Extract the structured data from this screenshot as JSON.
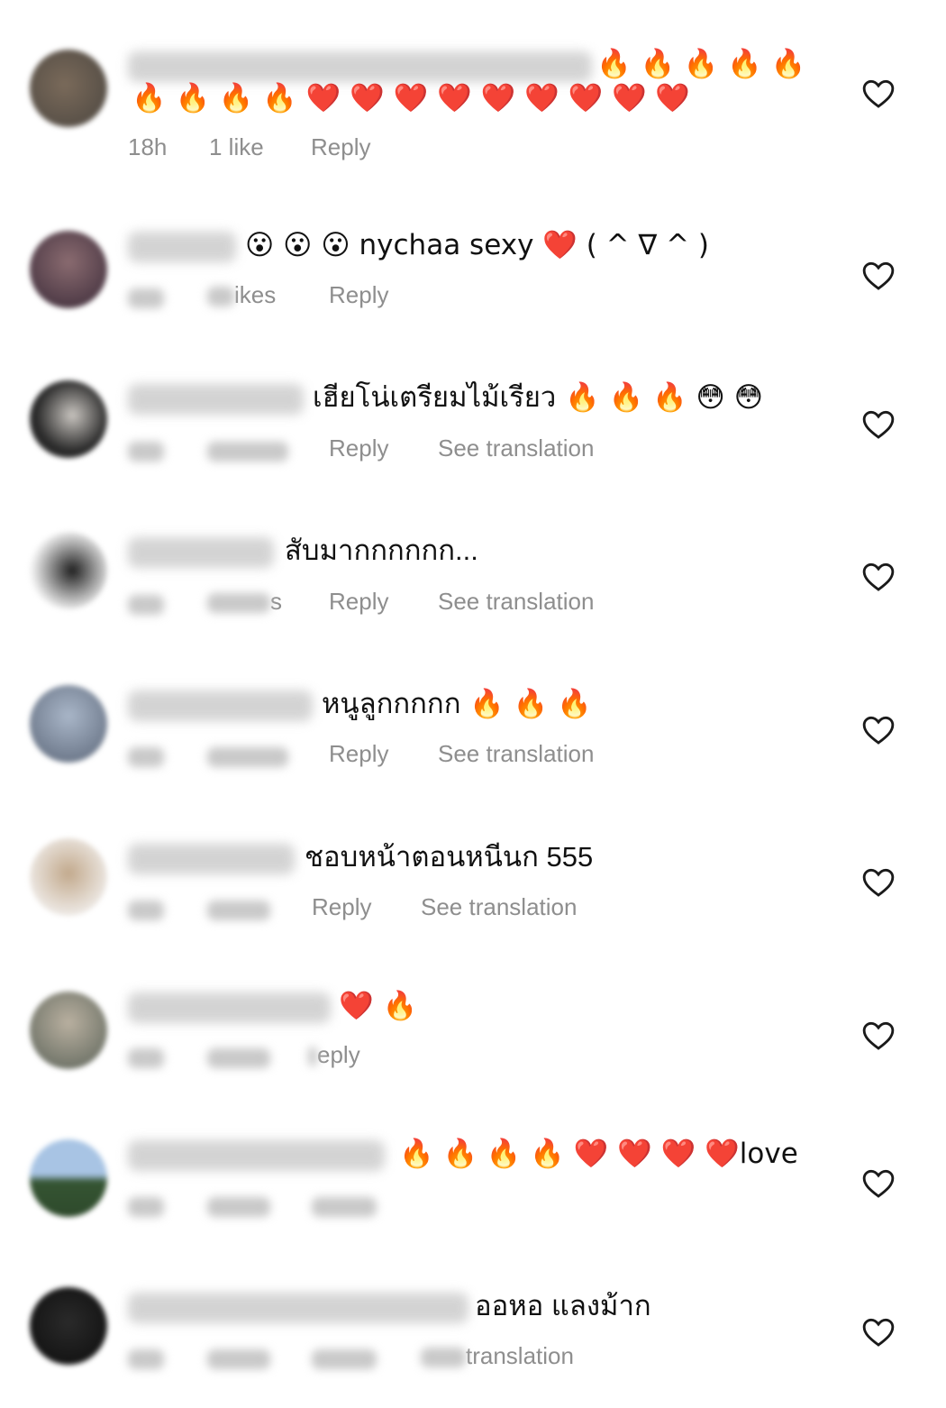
{
  "comments": [
    {
      "text_line1": "🔥 🔥 🔥 🔥 🔥",
      "text_line2": "🔥 🔥 🔥 🔥 ❤️ ❤️ ❤️ ❤️ ❤️ ❤️ ❤️ ❤️ ❤️",
      "time": "18h",
      "likes": "1 like",
      "reply": "Reply"
    },
    {
      "text": "😮 😮 😮 nychaa sexy ❤️ ( ^ ∇ ^ )",
      "likes_partial": "ikes",
      "reply": "Reply"
    },
    {
      "text": "เฮียโน่เตรียมไม้เรียว 🔥 🔥 🔥 😳 😳",
      "reply": "Reply",
      "see_translation": "See translation"
    },
    {
      "text": "สับมากกกกกก...",
      "likes_partial": "s",
      "reply": "Reply",
      "see_translation": "See translation"
    },
    {
      "text": "หนูลูกกกกก 🔥 🔥 🔥",
      "reply": "Reply",
      "see_translation": "See translation"
    },
    {
      "text": "ชอบหน้าตอนหนีนก 555",
      "reply": "Reply",
      "see_translation": "See translation"
    },
    {
      "text": "❤️ 🔥",
      "reply_partial": "eply"
    },
    {
      "text": "🔥 🔥 🔥 🔥 ❤️ ❤️ ❤️ ❤️love"
    },
    {
      "text": "ออหอ แลงม้าก",
      "translation_partial": "translation"
    }
  ],
  "icons": {
    "like": "heart-outline-icon"
  },
  "colors": {
    "meta_text": "#8e8e8e",
    "heart": "#e0202b",
    "fire": "#f0802a"
  }
}
